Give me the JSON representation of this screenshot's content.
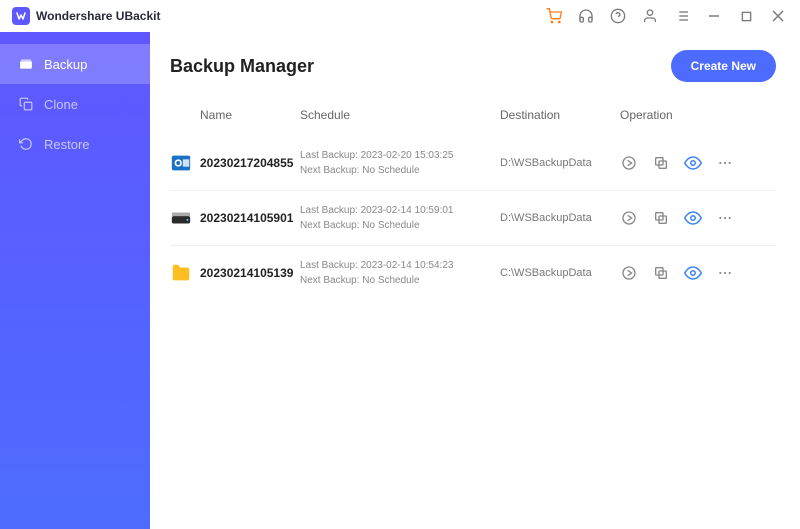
{
  "app": {
    "title": "Wondershare UBackit"
  },
  "sidebar": {
    "items": [
      {
        "label": "Backup",
        "icon": "backup-icon",
        "active": true
      },
      {
        "label": "Clone",
        "icon": "clone-icon",
        "active": false
      },
      {
        "label": "Restore",
        "icon": "restore-icon",
        "active": false
      }
    ]
  },
  "page": {
    "title": "Backup Manager",
    "create_label": "Create New",
    "columns": {
      "name": "Name",
      "schedule": "Schedule",
      "destination": "Destination",
      "operation": "Operation"
    }
  },
  "rows": [
    {
      "icon": "outlook-icon",
      "icon_color": "#1b70c7",
      "name": "20230217204855",
      "last_label": "Last Backup: 2023-02-20 15:03:25",
      "next_label": "Next Backup: No Schedule",
      "destination": "D:\\WSBackupData"
    },
    {
      "icon": "disk-icon",
      "icon_color": "#2b2b2b",
      "name": "20230214105901",
      "last_label": "Last Backup: 2023-02-14 10:59:01",
      "next_label": "Next Backup: No Schedule",
      "destination": "D:\\WSBackupData"
    },
    {
      "icon": "folder-icon",
      "icon_color": "#fbbf24",
      "name": "20230214105139",
      "last_label": "Last Backup: 2023-02-14 10:54:23",
      "next_label": "Next Backup: No Schedule",
      "destination": "C:\\WSBackupData"
    }
  ]
}
